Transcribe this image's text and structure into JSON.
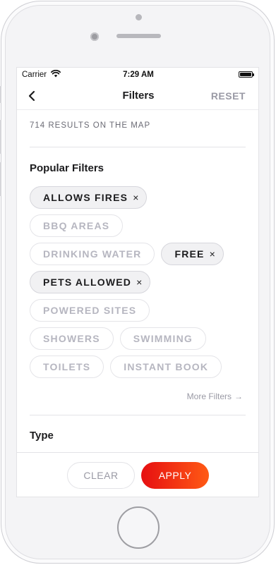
{
  "status_bar": {
    "carrier": "Carrier",
    "time": "7:29 AM"
  },
  "nav": {
    "title": "Filters",
    "reset_label": "RESET",
    "back_icon": "chevron-left-icon"
  },
  "results_text": "714 RESULTS ON THE MAP",
  "popular": {
    "title": "Popular Filters",
    "rows": [
      [
        {
          "label": "ALLOWS FIRES",
          "selected": true
        }
      ],
      [
        {
          "label": "BBQ AREAS",
          "selected": false
        }
      ],
      [
        {
          "label": "DRINKING WATER",
          "selected": false
        },
        {
          "label": "FREE",
          "selected": true
        }
      ],
      [
        {
          "label": "PETS ALLOWED",
          "selected": true
        }
      ],
      [
        {
          "label": "POWERED SITES",
          "selected": false
        }
      ],
      [
        {
          "label": "SHOWERS",
          "selected": false
        },
        {
          "label": "SWIMMING",
          "selected": false
        }
      ],
      [
        {
          "label": "TOILETS",
          "selected": false
        },
        {
          "label": "INSTANT BOOK",
          "selected": false
        }
      ]
    ],
    "remove_glyph": "×"
  },
  "more_filters": {
    "label": "More Filters",
    "arrow": "→"
  },
  "type_section": {
    "title": "Type"
  },
  "footer": {
    "clear_label": "CLEAR",
    "apply_label": "APPLY"
  },
  "colors": {
    "accent_start": "#e60f12",
    "accent_end": "#ff5a14",
    "muted": "#9a9aa5"
  }
}
